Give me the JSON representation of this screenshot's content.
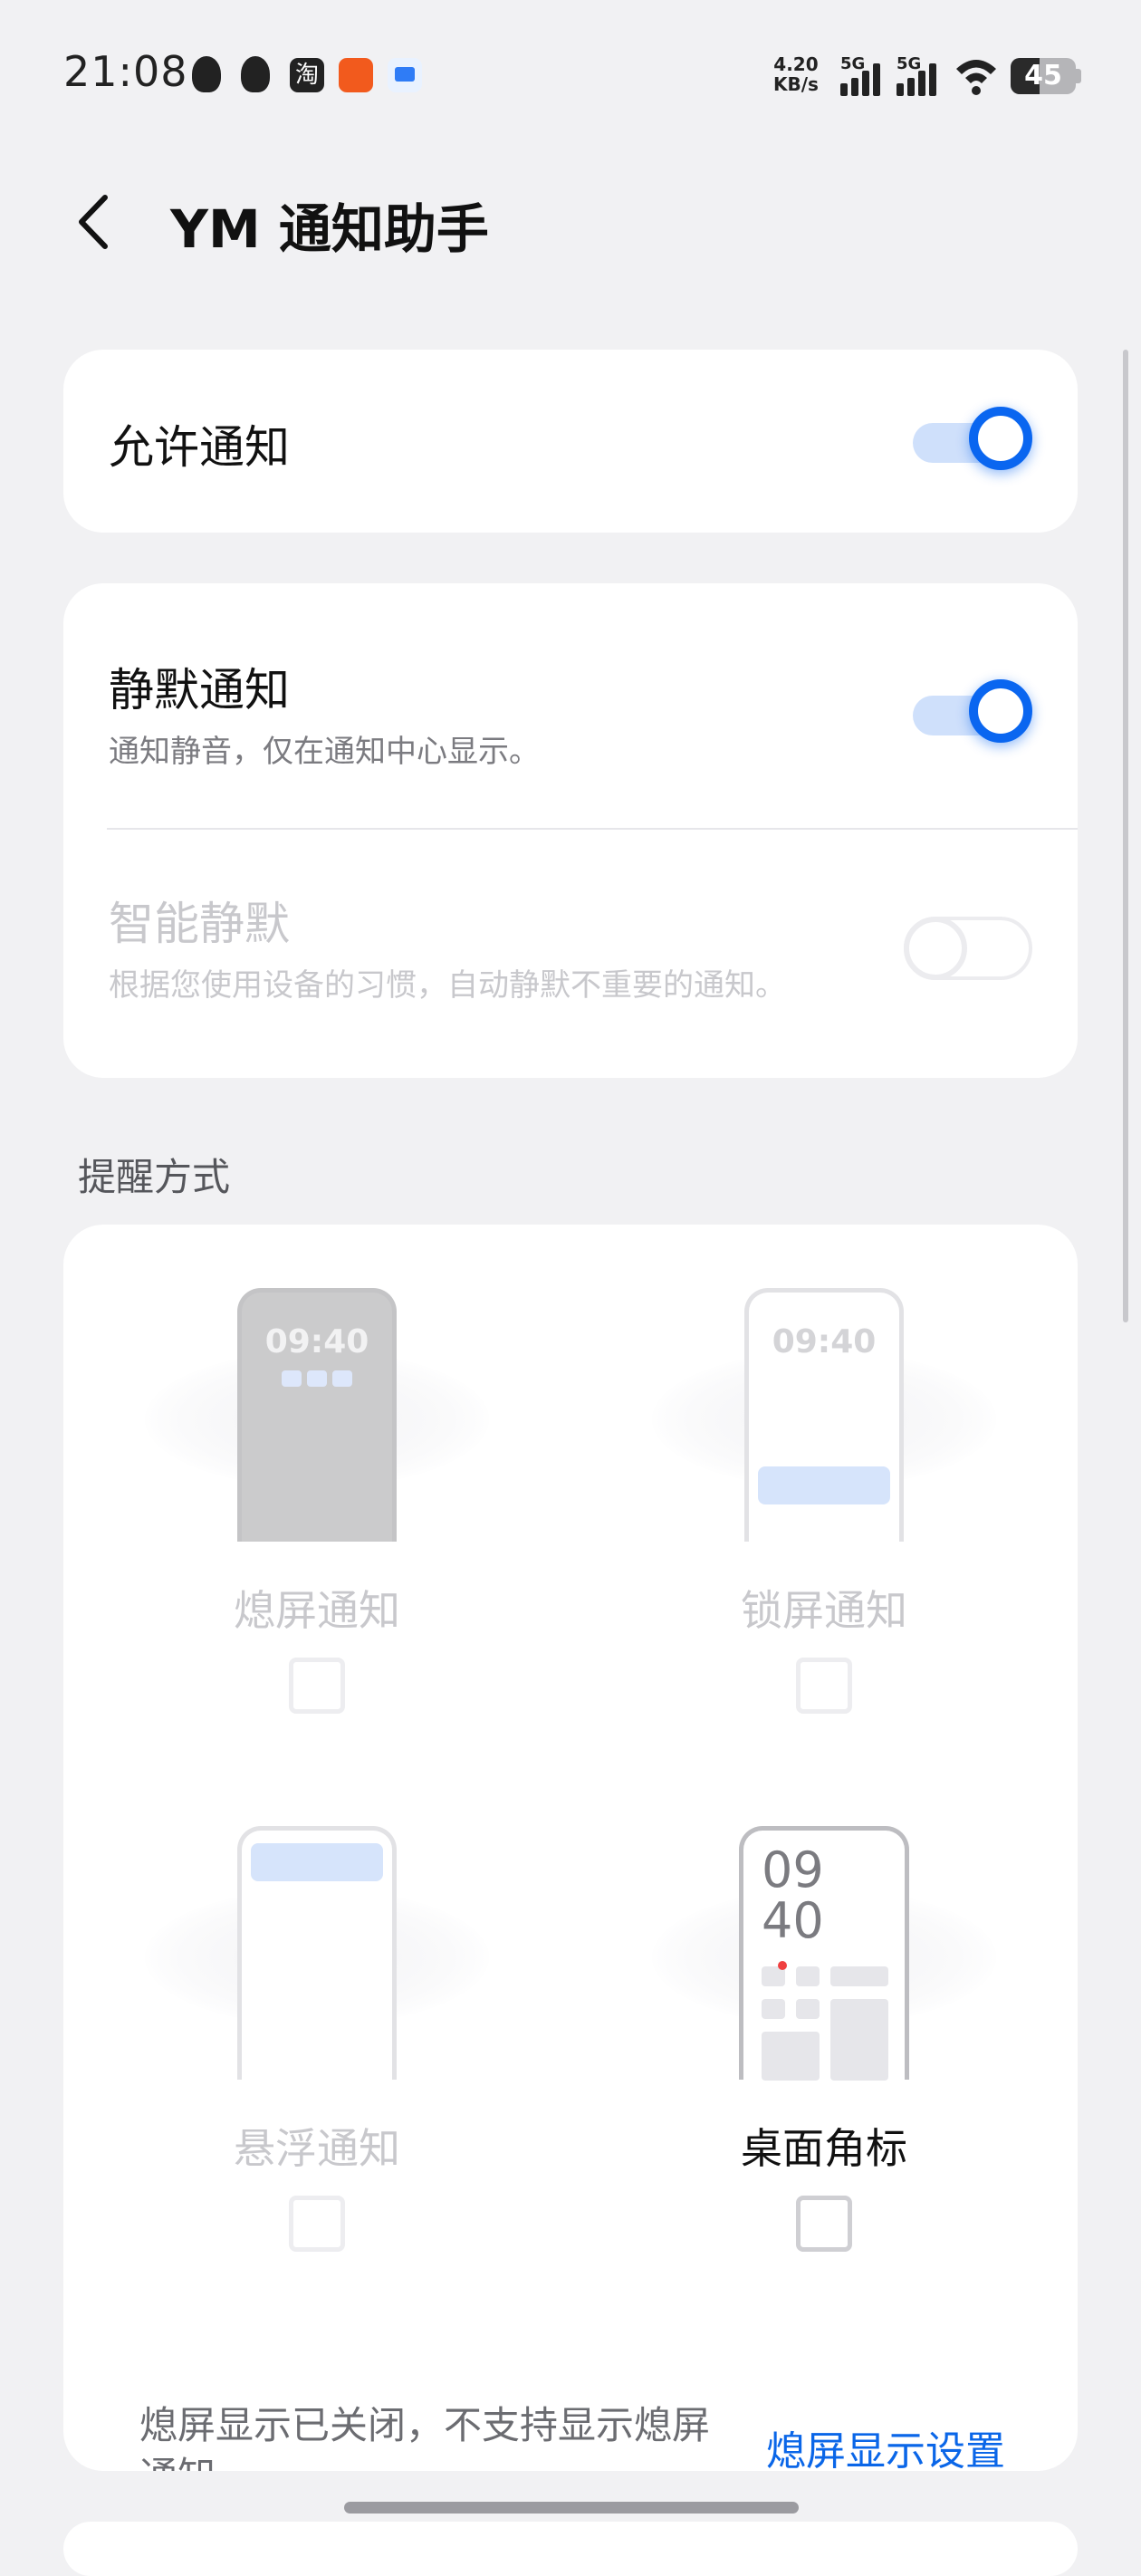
{
  "status_bar": {
    "time": "21:08",
    "net_speed_value": "4.20",
    "net_speed_unit": "KB/s",
    "sig1_label": "5G",
    "sig2_label": "5G",
    "battery": "45",
    "app_icons": [
      "qq-icon",
      "qq-icon",
      "taobao-icon",
      "pinduoduo-icon",
      "message-app-icon"
    ]
  },
  "header": {
    "title": "YM 通知助手"
  },
  "allow_notification": {
    "label": "允许通知",
    "enabled": true
  },
  "silent_card": {
    "silent": {
      "label": "静默通知",
      "desc": "通知静音，仅在通知中心显示。",
      "enabled": true
    },
    "smart_silent": {
      "label": "智能静默",
      "desc": "根据您使用设备的习惯，自动静默不重要的通知。",
      "enabled": false,
      "disabled": true
    }
  },
  "reminder": {
    "section_label": "提醒方式",
    "options": [
      {
        "label": "熄屏通知",
        "preview_time": "09:40",
        "checked": false,
        "disabled": true
      },
      {
        "label": "锁屏通知",
        "preview_time": "09:40",
        "checked": false,
        "disabled": true
      },
      {
        "label": "悬浮通知",
        "checked": false,
        "disabled": true
      },
      {
        "label": "桌面角标",
        "preview_hour": "09",
        "preview_minute": "40",
        "checked": false,
        "disabled": false
      }
    ],
    "footer_note": "熄屏显示已关闭，不支持显示熄屏通知。",
    "footer_link": "熄屏显示设置"
  },
  "colors": {
    "accent": "#0a66f0",
    "link": "#0a66e8",
    "background": "#f1f1f3"
  }
}
